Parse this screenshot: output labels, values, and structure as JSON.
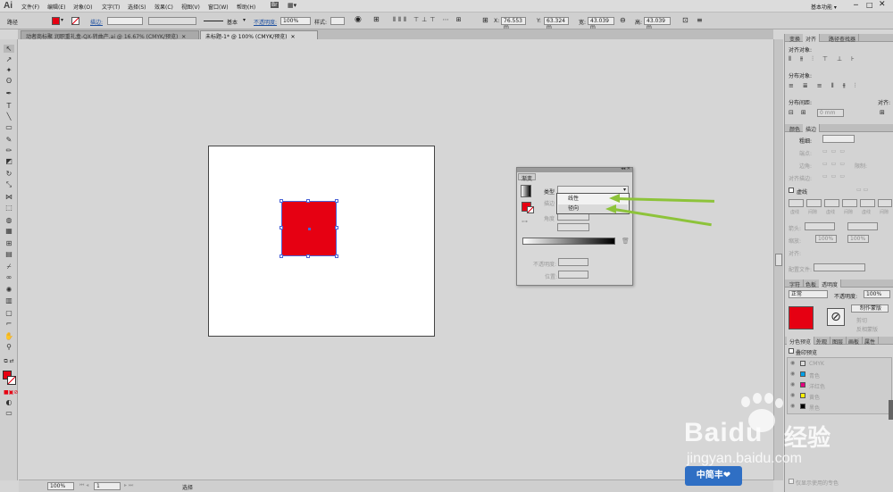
{
  "app": {
    "logo": "Ai",
    "workspace": "基本功能 ▾"
  },
  "menu": [
    "文件(F)",
    "编辑(E)",
    "对象(O)",
    "文字(T)",
    "选择(S)",
    "效果(C)",
    "视图(V)",
    "窗口(W)",
    "帮助(H)"
  ],
  "menu_extra": {
    "br": "Br",
    "layout": "▦▾"
  },
  "control": {
    "path_label": "路径",
    "stroke_label": "描边:",
    "brush_label": "基本",
    "opacity_label": "不透明度:",
    "opacity_value": "100%",
    "style_label": "样式:",
    "x": "76.553 m",
    "y": "63.324 m",
    "w": "43.039 m",
    "h": "43.039 m"
  },
  "tabs": [
    {
      "label": "动者商标聚 润职重礼盒-QX-转曲产.ai @ 16.67% (CMYK/预览)",
      "active": false
    },
    {
      "label": "未标题-1* @ 100% (CMYK/预览)",
      "active": true
    }
  ],
  "gradient_panel": {
    "title": "渐变",
    "type_label": "类型",
    "stroke_label": "描边",
    "angle_label": "角度",
    "options": [
      "线性",
      "径向"
    ],
    "opacity_label": "不透明度:",
    "position_label": "位置:"
  },
  "panels": {
    "top_tabs": [
      "变换",
      "对齐",
      "路径查找器"
    ],
    "align_objects": "对齐对象:",
    "distribute_objects": "分布对象:",
    "distribute_spacing": "分布间距:",
    "align_to": "对齐:",
    "spacing_value": "0 mm",
    "stroke_tabs": [
      "颜色",
      "描边"
    ],
    "weight_label": "粗细:",
    "cap_label": "端点:",
    "corner_label": "边角:",
    "align_stroke_label": "对齐描边:",
    "limit_label": "限制:",
    "dashed_label": "虚线",
    "dash_fields": [
      "虚线",
      "间隙",
      "虚线",
      "间隙",
      "虚线",
      "间隙"
    ],
    "arrow_label": "箭头:",
    "scale_label": "缩放:",
    "scale_a": "100%",
    "scale_b": "100%",
    "arrow_align_label": "对齐:",
    "profile_label": "配置文件:",
    "trans_tabs": [
      "字符",
      "色板",
      "透明度"
    ],
    "blend_mode": "正常",
    "opacity_label": "不透明度:",
    "opacity_value": "100%",
    "make_mask": "制作蒙版",
    "clip": "剪切",
    "invert": "反相蒙版",
    "sep_tabs": [
      "分色预览",
      "外观",
      "图层",
      "画板",
      "属性"
    ],
    "overprint": "叠印预览",
    "separations": [
      {
        "name": "CMYK",
        "color": "#666666"
      },
      {
        "name": "青色",
        "color": "#00a0e9"
      },
      {
        "name": "洋红色",
        "color": "#e4007f"
      },
      {
        "name": "黄色",
        "color": "#fff100"
      },
      {
        "name": "黑色",
        "color": "#000000"
      }
    ],
    "spot_only": "仅显示使用的专色"
  },
  "status": {
    "zoom": "100%",
    "page": "1",
    "tool": "选择"
  },
  "watermark": {
    "brand": "Baidu",
    "cn": "经验",
    "url": "jingyan.baidu.com",
    "badge": "中简丰❤"
  },
  "colors": {
    "fill": "#e60012",
    "arrow": "#8dc33a",
    "selection": "#4b63d6"
  }
}
